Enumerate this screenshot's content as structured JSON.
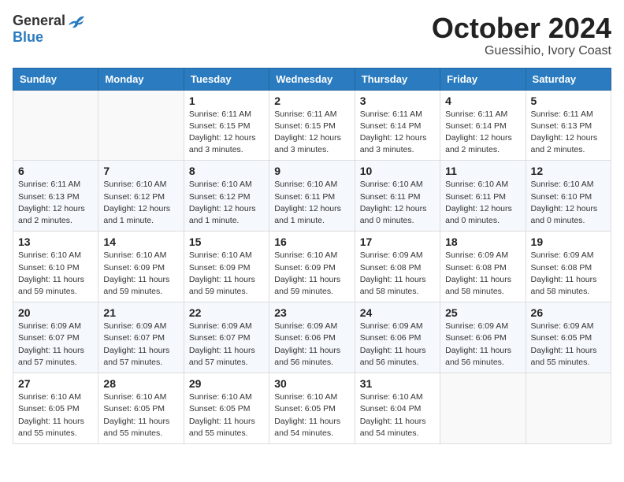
{
  "header": {
    "logo_general": "General",
    "logo_blue": "Blue",
    "title": "October 2024",
    "location": "Guessihio, Ivory Coast"
  },
  "weekdays": [
    "Sunday",
    "Monday",
    "Tuesday",
    "Wednesday",
    "Thursday",
    "Friday",
    "Saturday"
  ],
  "weeks": [
    [
      {
        "day": "",
        "info": ""
      },
      {
        "day": "",
        "info": ""
      },
      {
        "day": "1",
        "info": "Sunrise: 6:11 AM\nSunset: 6:15 PM\nDaylight: 12 hours\nand 3 minutes."
      },
      {
        "day": "2",
        "info": "Sunrise: 6:11 AM\nSunset: 6:15 PM\nDaylight: 12 hours\nand 3 minutes."
      },
      {
        "day": "3",
        "info": "Sunrise: 6:11 AM\nSunset: 6:14 PM\nDaylight: 12 hours\nand 3 minutes."
      },
      {
        "day": "4",
        "info": "Sunrise: 6:11 AM\nSunset: 6:14 PM\nDaylight: 12 hours\nand 2 minutes."
      },
      {
        "day": "5",
        "info": "Sunrise: 6:11 AM\nSunset: 6:13 PM\nDaylight: 12 hours\nand 2 minutes."
      }
    ],
    [
      {
        "day": "6",
        "info": "Sunrise: 6:11 AM\nSunset: 6:13 PM\nDaylight: 12 hours\nand 2 minutes."
      },
      {
        "day": "7",
        "info": "Sunrise: 6:10 AM\nSunset: 6:12 PM\nDaylight: 12 hours\nand 1 minute."
      },
      {
        "day": "8",
        "info": "Sunrise: 6:10 AM\nSunset: 6:12 PM\nDaylight: 12 hours\nand 1 minute."
      },
      {
        "day": "9",
        "info": "Sunrise: 6:10 AM\nSunset: 6:11 PM\nDaylight: 12 hours\nand 1 minute."
      },
      {
        "day": "10",
        "info": "Sunrise: 6:10 AM\nSunset: 6:11 PM\nDaylight: 12 hours\nand 0 minutes."
      },
      {
        "day": "11",
        "info": "Sunrise: 6:10 AM\nSunset: 6:11 PM\nDaylight: 12 hours\nand 0 minutes."
      },
      {
        "day": "12",
        "info": "Sunrise: 6:10 AM\nSunset: 6:10 PM\nDaylight: 12 hours\nand 0 minutes."
      }
    ],
    [
      {
        "day": "13",
        "info": "Sunrise: 6:10 AM\nSunset: 6:10 PM\nDaylight: 11 hours\nand 59 minutes."
      },
      {
        "day": "14",
        "info": "Sunrise: 6:10 AM\nSunset: 6:09 PM\nDaylight: 11 hours\nand 59 minutes."
      },
      {
        "day": "15",
        "info": "Sunrise: 6:10 AM\nSunset: 6:09 PM\nDaylight: 11 hours\nand 59 minutes."
      },
      {
        "day": "16",
        "info": "Sunrise: 6:10 AM\nSunset: 6:09 PM\nDaylight: 11 hours\nand 59 minutes."
      },
      {
        "day": "17",
        "info": "Sunrise: 6:09 AM\nSunset: 6:08 PM\nDaylight: 11 hours\nand 58 minutes."
      },
      {
        "day": "18",
        "info": "Sunrise: 6:09 AM\nSunset: 6:08 PM\nDaylight: 11 hours\nand 58 minutes."
      },
      {
        "day": "19",
        "info": "Sunrise: 6:09 AM\nSunset: 6:08 PM\nDaylight: 11 hours\nand 58 minutes."
      }
    ],
    [
      {
        "day": "20",
        "info": "Sunrise: 6:09 AM\nSunset: 6:07 PM\nDaylight: 11 hours\nand 57 minutes."
      },
      {
        "day": "21",
        "info": "Sunrise: 6:09 AM\nSunset: 6:07 PM\nDaylight: 11 hours\nand 57 minutes."
      },
      {
        "day": "22",
        "info": "Sunrise: 6:09 AM\nSunset: 6:07 PM\nDaylight: 11 hours\nand 57 minutes."
      },
      {
        "day": "23",
        "info": "Sunrise: 6:09 AM\nSunset: 6:06 PM\nDaylight: 11 hours\nand 56 minutes."
      },
      {
        "day": "24",
        "info": "Sunrise: 6:09 AM\nSunset: 6:06 PM\nDaylight: 11 hours\nand 56 minutes."
      },
      {
        "day": "25",
        "info": "Sunrise: 6:09 AM\nSunset: 6:06 PM\nDaylight: 11 hours\nand 56 minutes."
      },
      {
        "day": "26",
        "info": "Sunrise: 6:09 AM\nSunset: 6:05 PM\nDaylight: 11 hours\nand 55 minutes."
      }
    ],
    [
      {
        "day": "27",
        "info": "Sunrise: 6:10 AM\nSunset: 6:05 PM\nDaylight: 11 hours\nand 55 minutes."
      },
      {
        "day": "28",
        "info": "Sunrise: 6:10 AM\nSunset: 6:05 PM\nDaylight: 11 hours\nand 55 minutes."
      },
      {
        "day": "29",
        "info": "Sunrise: 6:10 AM\nSunset: 6:05 PM\nDaylight: 11 hours\nand 55 minutes."
      },
      {
        "day": "30",
        "info": "Sunrise: 6:10 AM\nSunset: 6:05 PM\nDaylight: 11 hours\nand 54 minutes."
      },
      {
        "day": "31",
        "info": "Sunrise: 6:10 AM\nSunset: 6:04 PM\nDaylight: 11 hours\nand 54 minutes."
      },
      {
        "day": "",
        "info": ""
      },
      {
        "day": "",
        "info": ""
      }
    ]
  ]
}
